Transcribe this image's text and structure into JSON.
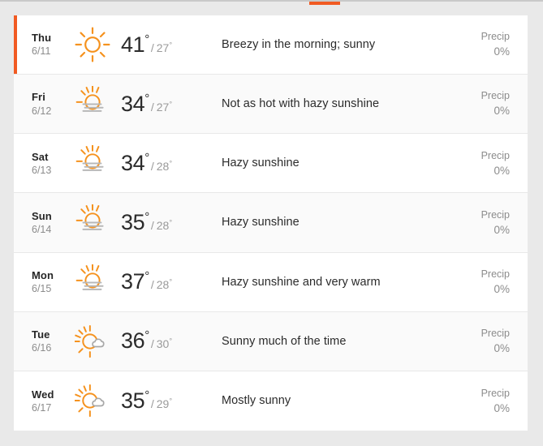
{
  "theme": {
    "accent_color": "#f15a22",
    "sun_color": "#f5921e",
    "cloud_color": "#a8a8a8",
    "haze_color": "#b8b8b8",
    "page_background": "#e9e9e9",
    "card_background": "#ffffff",
    "row_alt_background": "#fafafa",
    "text_primary": "#2b2b2b",
    "text_muted": "#8c8c8c"
  },
  "tabs": {
    "active_indicator_color": "#f15a22"
  },
  "forecast": {
    "precip_label": "Precip",
    "degree_symbol": "°",
    "separator": "/",
    "days": [
      {
        "day": "Thu",
        "date": "6/11",
        "icon": "sunny-icon",
        "high": "41",
        "low": "27",
        "description": "Breezy in the morning; sunny",
        "precip_label": "Precip",
        "precip": "0%",
        "active": true
      },
      {
        "day": "Fri",
        "date": "6/12",
        "icon": "hazy-sunshine-icon",
        "high": "34",
        "low": "27",
        "description": "Not as hot with hazy sunshine",
        "precip_label": "Precip",
        "precip": "0%",
        "active": false
      },
      {
        "day": "Sat",
        "date": "6/13",
        "icon": "hazy-sunshine-icon",
        "high": "34",
        "low": "28",
        "description": "Hazy sunshine",
        "precip_label": "Precip",
        "precip": "0%",
        "active": false
      },
      {
        "day": "Sun",
        "date": "6/14",
        "icon": "hazy-sunshine-icon",
        "high": "35",
        "low": "28",
        "description": "Hazy sunshine",
        "precip_label": "Precip",
        "precip": "0%",
        "active": false
      },
      {
        "day": "Mon",
        "date": "6/15",
        "icon": "hazy-sunshine-icon",
        "high": "37",
        "low": "28",
        "description": "Hazy sunshine and very warm",
        "precip_label": "Precip",
        "precip": "0%",
        "active": false
      },
      {
        "day": "Tue",
        "date": "6/16",
        "icon": "partly-sunny-icon",
        "high": "36",
        "low": "30",
        "description": "Sunny much of the time",
        "precip_label": "Precip",
        "precip": "0%",
        "active": false
      },
      {
        "day": "Wed",
        "date": "6/17",
        "icon": "partly-sunny-icon",
        "high": "35",
        "low": "29",
        "description": "Mostly sunny",
        "precip_label": "Precip",
        "precip": "0%",
        "active": false
      }
    ]
  }
}
